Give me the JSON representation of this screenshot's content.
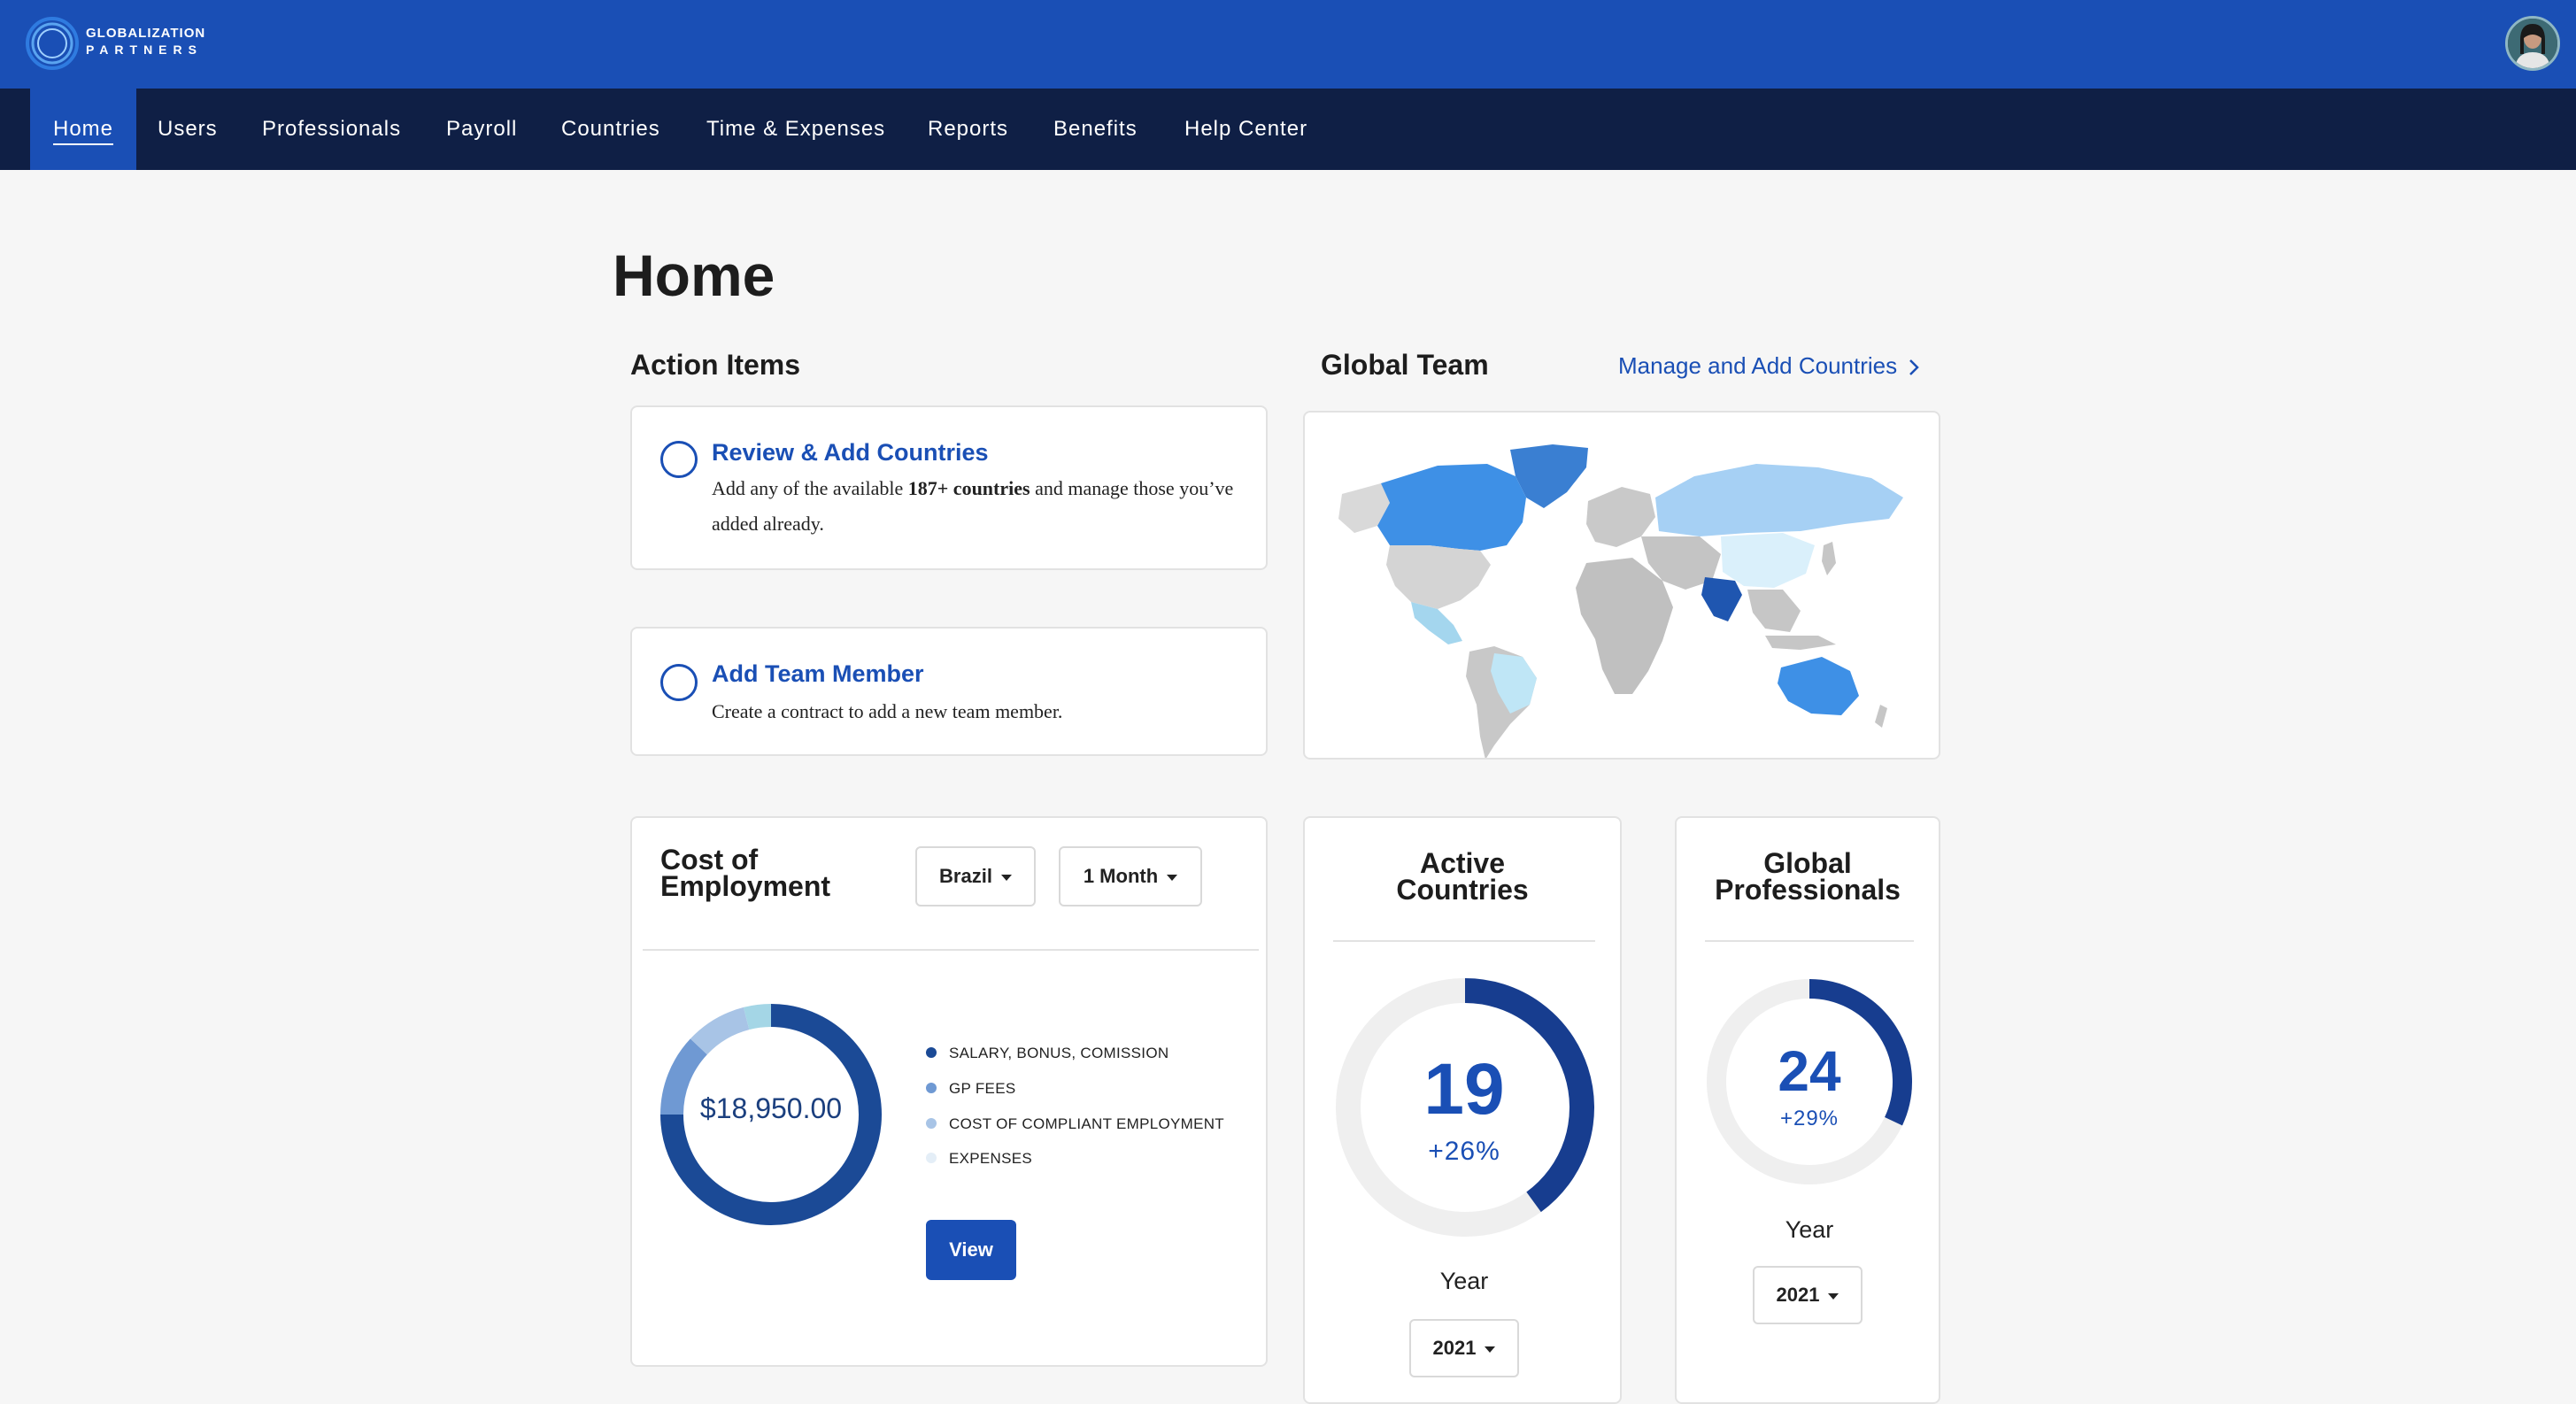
{
  "brand": {
    "line1": "GLOBALIZATION",
    "line2": "PARTNERS",
    "primary_color": "#1a4fb5",
    "nav_color": "#0f1f45"
  },
  "nav": {
    "items": [
      "Home",
      "Users",
      "Professionals",
      "Payroll",
      "Countries",
      "Time & Expenses",
      "Reports",
      "Benefits",
      "Help Center"
    ],
    "active": "Home"
  },
  "page": {
    "title": "Home"
  },
  "action_items": {
    "title": "Action Items",
    "items": [
      {
        "title": "Review & Add Countries",
        "desc_before": "Add any of the available ",
        "desc_bold": "187+ countries",
        "desc_after": " and manage those you’ve added already."
      },
      {
        "title": "Add Team Member",
        "desc": "Create a contract to add a new team member."
      }
    ]
  },
  "global_team": {
    "title": "Global Team",
    "manage_link": "Manage and Add Countries",
    "map_icon": "world-map"
  },
  "cost_of_employment": {
    "title_line1": "Cost of",
    "title_line2": "Employment",
    "country_select": "Brazil",
    "period_select": "1 Month",
    "total": "$18,950.00",
    "legend": [
      {
        "label": "SALARY, BONUS, COMISSION",
        "color": "#1b4a96"
      },
      {
        "label": "GP FEES",
        "color": "#6f99d3"
      },
      {
        "label": "COST OF COMPLIANT EMPLOYMENT",
        "color": "#a8c4e6"
      },
      {
        "label": "EXPENSES",
        "color": "#e4eef7"
      }
    ],
    "segments": [
      {
        "fraction": 0.75,
        "color": "#1b4a96"
      },
      {
        "fraction": 0.12,
        "color": "#6f99d3"
      },
      {
        "fraction": 0.09,
        "color": "#a8c4e6"
      },
      {
        "fraction": 0.04,
        "color": "#a4d6e6"
      }
    ],
    "view_button": "View"
  },
  "active_countries": {
    "title_line1": "Active",
    "title_line2": "Countries",
    "value": "19",
    "change": "+26%",
    "progress": 0.4,
    "year_label": "Year",
    "year": "2021"
  },
  "global_professionals": {
    "title_line1": "Global",
    "title_line2": "Professionals",
    "value": "24",
    "change": "+29%",
    "progress": 0.32,
    "year_label": "Year",
    "year": "2021"
  }
}
